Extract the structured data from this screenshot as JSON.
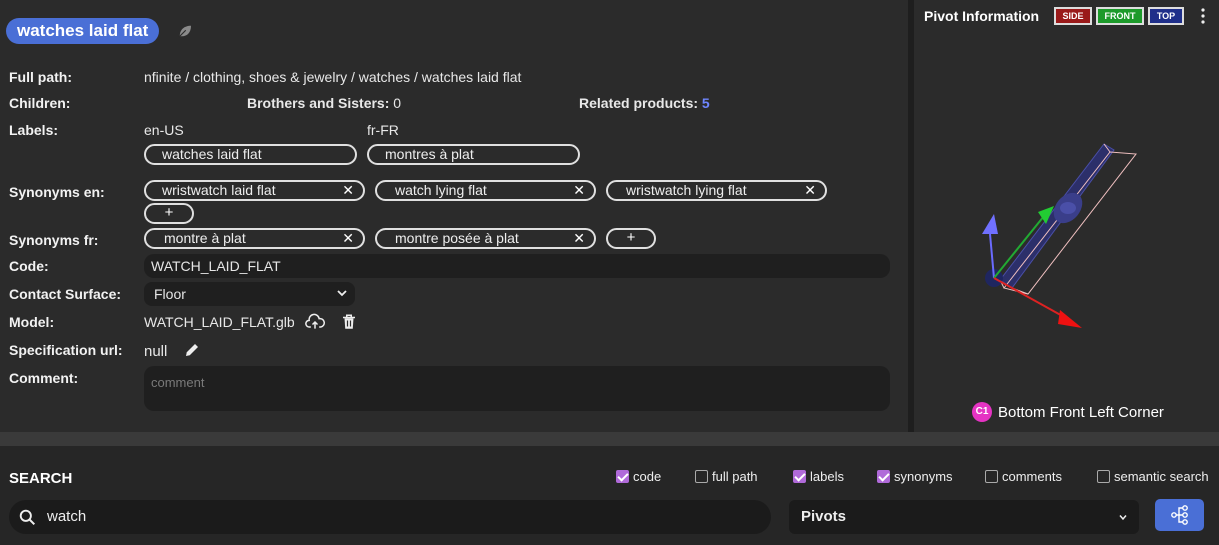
{
  "item": {
    "title": "watches laid flat",
    "full_path_label": "Full path:",
    "full_path": "nfinite / clothing, shoes & jewelry / watches / watches laid flat",
    "children_label": "Children:",
    "siblings_label": "Brothers and Sisters:",
    "siblings_count": "0",
    "related_label": "Related products:",
    "related_count": "5",
    "labels_label": "Labels:",
    "labels": [
      {
        "locale": "en-US",
        "value": "watches laid flat"
      },
      {
        "locale": "fr-FR",
        "value": "montres à plat"
      }
    ],
    "synonyms_en_label": "Synonyms en:",
    "synonyms_en": [
      "wristwatch laid flat",
      "watch lying flat",
      "wristwatch lying flat"
    ],
    "synonyms_fr_label": "Synonyms fr:",
    "synonyms_fr": [
      "montre à plat",
      "montre posée à plat"
    ],
    "add_symbol": "+",
    "remove_symbol": "✕",
    "code_label": "Code:",
    "code": "WATCH_LAID_FLAT",
    "contact_label": "Contact Surface:",
    "contact_value": "Floor",
    "model_label": "Model:",
    "model_file": "WATCH_LAID_FLAT.glb",
    "spec_label": "Specification url:",
    "spec_value": "null",
    "comment_label": "Comment:",
    "comment_placeholder": "comment"
  },
  "pivot": {
    "title": "Pivot Information",
    "views": [
      {
        "label": "SIDE",
        "color": "#9a1a1a"
      },
      {
        "label": "FRONT",
        "color": "#1c9a2a"
      },
      {
        "label": "TOP",
        "color": "#1f2f8a"
      }
    ],
    "corner_badge": "C1",
    "corner_label": "Bottom Front Left Corner"
  },
  "search": {
    "title": "SEARCH",
    "filters": [
      {
        "label": "code",
        "checked": true
      },
      {
        "label": "full path",
        "checked": false
      },
      {
        "label": "labels",
        "checked": true
      },
      {
        "label": "synonyms",
        "checked": true
      },
      {
        "label": "comments",
        "checked": false
      },
      {
        "label": "semantic search",
        "checked": false
      }
    ],
    "query": "watch",
    "type_value": "Pivots"
  },
  "colors": {
    "accent": "#4a6fd6",
    "checkbox": "#b06ad9",
    "link_count": "#6f86ff",
    "corner_badge": "#e533c3"
  }
}
